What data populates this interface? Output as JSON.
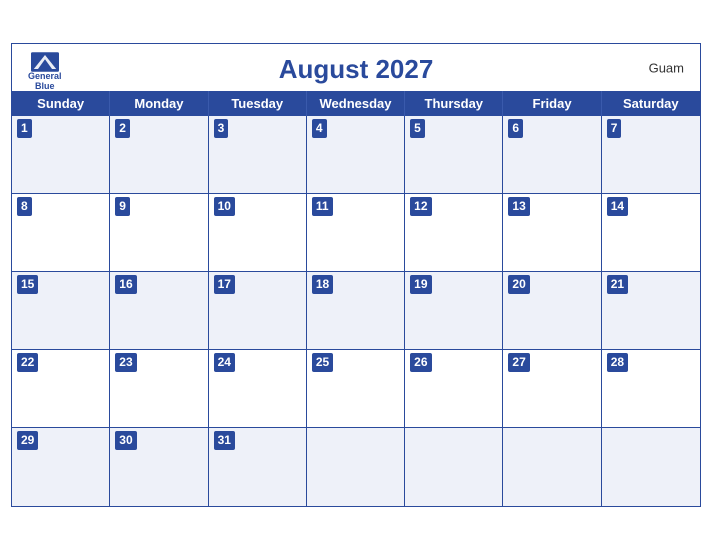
{
  "header": {
    "title": "August 2027",
    "region": "Guam",
    "logo_general": "General",
    "logo_blue": "Blue"
  },
  "days": [
    "Sunday",
    "Monday",
    "Tuesday",
    "Wednesday",
    "Thursday",
    "Friday",
    "Saturday"
  ],
  "weeks": [
    [
      1,
      2,
      3,
      4,
      5,
      6,
      7
    ],
    [
      8,
      9,
      10,
      11,
      12,
      13,
      14
    ],
    [
      15,
      16,
      17,
      18,
      19,
      20,
      21
    ],
    [
      22,
      23,
      24,
      25,
      26,
      27,
      28
    ],
    [
      29,
      30,
      31,
      null,
      null,
      null,
      null
    ]
  ],
  "colors": {
    "primary": "#2a4a9c",
    "stripe": "#eef1f9",
    "white": "#ffffff"
  }
}
